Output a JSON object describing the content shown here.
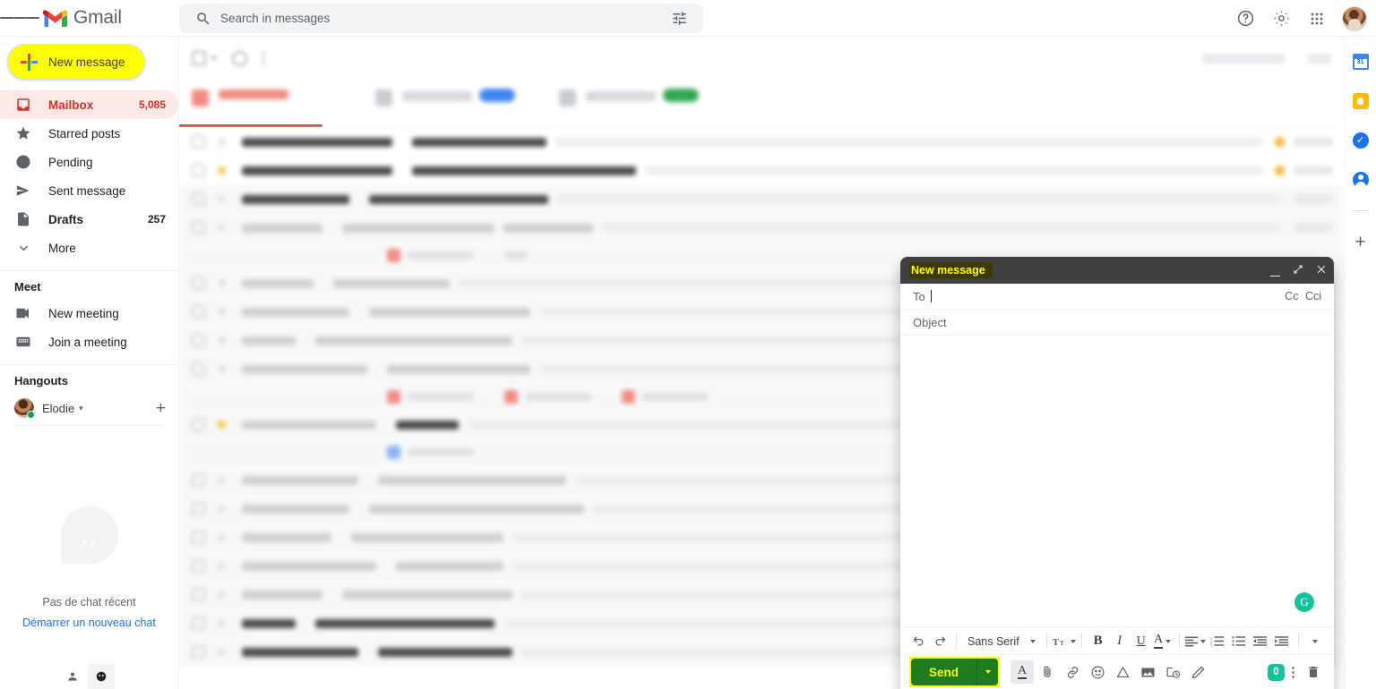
{
  "header": {
    "menu_icon": "hamburger-icon",
    "brand": "Gmail",
    "logo_icon": "gmail-logo-icon",
    "search": {
      "placeholder": "Search in messages",
      "value": "",
      "icon": "search-icon",
      "options_icon": "tune-icon"
    },
    "help_icon": "help-icon",
    "settings_icon": "gear-icon",
    "apps_icon": "apps-grid-icon",
    "account_icon": "account-avatar"
  },
  "sidebar": {
    "compose": {
      "label": "New message",
      "icon": "plus-icon",
      "highlight": "#ffff00"
    },
    "items": [
      {
        "label": "Mailbox",
        "count": "5,085",
        "icon": "inbox-icon",
        "active": true,
        "bold": true
      },
      {
        "label": "Starred posts",
        "count": "",
        "icon": "star-icon",
        "active": false,
        "bold": false
      },
      {
        "label": "Pending",
        "count": "",
        "icon": "clock-icon",
        "active": false,
        "bold": false
      },
      {
        "label": "Sent message",
        "count": "",
        "icon": "send-icon",
        "active": false,
        "bold": false
      },
      {
        "label": "Drafts",
        "count": "257",
        "icon": "drafts-icon",
        "active": false,
        "bold": true
      },
      {
        "label": "More",
        "count": "",
        "icon": "chevron-down-icon",
        "active": false,
        "bold": false
      }
    ],
    "meet": {
      "title": "Meet",
      "items": [
        {
          "label": "New meeting",
          "icon": "video-camera-icon"
        },
        {
          "label": "Join a meeting",
          "icon": "keyboard-icon"
        }
      ]
    },
    "hangouts": {
      "title": "Hangouts",
      "user": "Elodie",
      "status": "online",
      "caret": "▾",
      "add_icon": "plus-icon",
      "empty_text": "Pas de chat récent",
      "empty_link": "Démarrer un nouveau chat",
      "bubble_icon": "chat-bubble-icon"
    },
    "bottom_icons": [
      {
        "name": "contacts-person-icon",
        "active": false
      },
      {
        "name": "phone-icon",
        "active": true
      }
    ]
  },
  "mail_list": {
    "blurred": true,
    "tabs_count": 3,
    "active_tab_accent": "#d93025",
    "tab_badges": [
      "#f28b82",
      "#4285f4",
      "#34a853"
    ],
    "row_count": 14
  },
  "right_rail": {
    "items": [
      {
        "name": "calendar-icon",
        "color": "#4285f4",
        "text": "31"
      },
      {
        "name": "keep-icon",
        "color": "#fbbc04",
        "text": ""
      },
      {
        "name": "tasks-icon",
        "color": "#1a73e8",
        "text": ""
      },
      {
        "name": "contacts-icon",
        "color": "#1a73e8",
        "text": ""
      }
    ],
    "add_label": "+"
  },
  "compose": {
    "title": "New message",
    "title_highlight": "#ffff00",
    "window_buttons": {
      "minimize": "minimize-icon",
      "expand": "expand-icon",
      "close": "close-icon"
    },
    "to": {
      "label": "To",
      "value": ""
    },
    "cc": "Cc",
    "bcc": "Cci",
    "subject": {
      "placeholder": "Object",
      "value": ""
    },
    "body": {
      "value": ""
    },
    "grammarly_badge": "G",
    "format_toolbar": [
      {
        "name": "undo-icon",
        "label": "↶"
      },
      {
        "name": "redo-icon",
        "label": "↷"
      },
      {
        "name": "font-family-select",
        "label": "Sans Serif"
      },
      {
        "name": "font-size-icon",
        "label": "T"
      },
      {
        "name": "bold-icon",
        "label": "B"
      },
      {
        "name": "italic-icon",
        "label": "I"
      },
      {
        "name": "underline-icon",
        "label": "U"
      },
      {
        "name": "text-color-icon",
        "label": "A"
      },
      {
        "name": "align-icon",
        "label": "≡"
      },
      {
        "name": "numbered-list-icon",
        "label": "1."
      },
      {
        "name": "bullet-list-icon",
        "label": "•"
      },
      {
        "name": "indent-less-icon",
        "label": "⇤"
      },
      {
        "name": "indent-more-icon",
        "label": "⇥"
      },
      {
        "name": "more-format-icon",
        "label": "▾"
      }
    ],
    "send": {
      "label": "Send",
      "bg": "#1e7b1e",
      "text_color": "#ffff00",
      "highlight": "#ffff00"
    },
    "action_icons": [
      {
        "name": "formatting-options-icon",
        "active": true
      },
      {
        "name": "attach-file-icon",
        "active": false
      },
      {
        "name": "insert-link-icon",
        "active": false
      },
      {
        "name": "insert-emoji-icon",
        "active": false
      },
      {
        "name": "insert-drive-icon",
        "active": false
      },
      {
        "name": "insert-photo-icon",
        "active": false
      },
      {
        "name": "confidential-mode-icon",
        "active": false
      },
      {
        "name": "insert-signature-icon",
        "active": false
      }
    ],
    "grammarly_count": "0",
    "more_options_icon": "more-vertical-icon",
    "discard_icon": "trash-icon"
  }
}
